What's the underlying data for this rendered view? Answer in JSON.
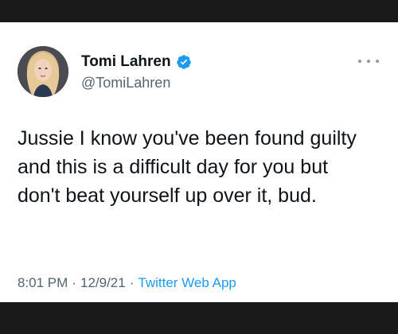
{
  "author": {
    "display_name": "Tomi Lahren",
    "handle": "@TomiLahren",
    "verified_icon": "verified-badge-icon",
    "avatar_icon": "profile-photo"
  },
  "menu": {
    "icon": "more-options-icon"
  },
  "tweet": {
    "text": "Jussie I know you've been found guilty and this is a difficult day for you but don't beat yourself up over it, bud.",
    "time": "8:01 PM",
    "date": "12/9/21",
    "separator": "·",
    "source": "Twitter Web App"
  },
  "colors": {
    "background_bar": "#1a1a1a",
    "card": "#ffffff",
    "text": "#0f1419",
    "secondary": "#536471",
    "link": "#1d9bf0",
    "verified": "#1d9bf0"
  }
}
